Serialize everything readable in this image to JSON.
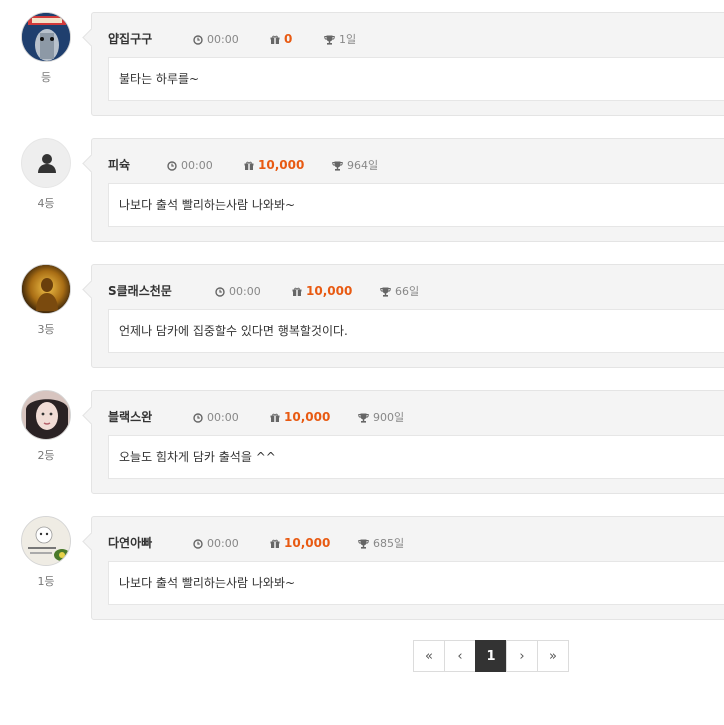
{
  "entries": [
    {
      "nick": "얍집구구",
      "time": "00:00",
      "point": "0",
      "days": "1일",
      "rank": "등",
      "msg": "불타는 하루를~",
      "avatar": "photo-dark-red"
    },
    {
      "nick": "피슉",
      "time": "00:00",
      "point": "10,000",
      "days": "964일",
      "rank": "4등",
      "msg": "나보다 출석 빨리하는사람 나와봐~",
      "avatar": "default-user"
    },
    {
      "nick": "S클래스천문",
      "time": "00:00",
      "point": "10,000",
      "days": "66일",
      "rank": "3등",
      "msg": "언제나 담카에 집중할수 있다면 행복할것이다.",
      "avatar": "photo-golden-statue"
    },
    {
      "nick": "블랙스완",
      "time": "00:00",
      "point": "10,000",
      "days": "900일",
      "rank": "2등",
      "msg": "오늘도 힘차게 담카 출석을 ^^",
      "avatar": "photo-woman"
    },
    {
      "nick": "다연아빠",
      "time": "00:00",
      "point": "10,000",
      "days": "685일",
      "rank": "1등",
      "msg": "나보다 출석 빨리하는사람 나와봐~",
      "avatar": "photo-cartoon"
    }
  ],
  "pagination": {
    "first": "«",
    "prev": "‹",
    "current": "1",
    "next": "›",
    "last": "»"
  },
  "colors": {
    "accent": "#e85a12",
    "active_page": "#333333"
  }
}
